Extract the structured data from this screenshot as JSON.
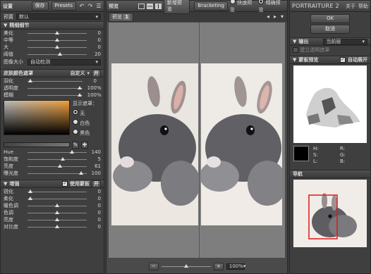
{
  "left": {
    "title": "设置",
    "save": "保存",
    "presets": "Presets",
    "preset_label": "预置",
    "preset_value": "默认",
    "detail": {
      "title": "精细细节",
      "rows": [
        {
          "label": "美化",
          "value": "0",
          "pos": 0.5
        },
        {
          "label": "中等",
          "value": "0",
          "pos": 0.5
        },
        {
          "label": "大",
          "value": "0",
          "pos": 0.5
        },
        {
          "label": "阈值",
          "value": "20",
          "pos": 0.55
        }
      ],
      "image_size_label": "图像大小",
      "image_size_value": "自动检测"
    },
    "skin": {
      "title": "皮肤颜色遮罩",
      "mode": "自定义",
      "rows": [
        {
          "label": "羽化",
          "value": "0",
          "pct": "",
          "pos": 0.05
        },
        {
          "label": "透明度",
          "value": "100",
          "pct": "%",
          "pos": 0.95
        },
        {
          "label": "模糊",
          "value": "100",
          "pct": "%",
          "pos": 0.95
        }
      ],
      "show_mask": "显示遮罩：",
      "options": [
        "无",
        "白色",
        "黑色"
      ],
      "hue_rows": [
        {
          "label": "Hue",
          "value": "140",
          "pos": 0.75
        },
        {
          "label": "饱和度",
          "value": "5",
          "pos": 0.6
        },
        {
          "label": "亮度",
          "value": "61",
          "pos": 0.55
        },
        {
          "label": "曝光度",
          "value": "100",
          "pos": 0.9
        }
      ]
    },
    "enhance": {
      "title": "增强",
      "use_mask": "使用蒙板",
      "rows": [
        {
          "label": "锐化",
          "value": "0",
          "pos": 0.05
        },
        {
          "label": "柔化",
          "value": "0",
          "pos": 0.05
        },
        {
          "label": "暖色调",
          "value": "0",
          "pos": 0.5
        },
        {
          "label": "色调",
          "value": "0",
          "pos": 0.5
        },
        {
          "label": "亮度",
          "value": "0",
          "pos": 0.5
        },
        {
          "label": "对比度",
          "value": "0",
          "pos": 0.5
        }
      ]
    }
  },
  "center": {
    "title": "预览",
    "new_preview": "新增预览",
    "bracketing": "Bracketing",
    "fast_preview": "快速预览",
    "precise_preview": "精确预览",
    "tab": "预览",
    "tab_num": "1",
    "zoom": "100%"
  },
  "right": {
    "brand": "PORTRAITURE 2",
    "about": "关于",
    "help": "帮助",
    "ok": "OK",
    "cancel": "取消",
    "output_label": "输出",
    "output_value": "当前层",
    "new_layer": "建立透明遮罩",
    "mask_preview": "蒙板预览",
    "auto_expand": "自动展开",
    "color_labels": [
      "H:",
      "S:",
      "L:",
      "R:",
      "G:",
      "B:"
    ],
    "nav": "导航"
  }
}
